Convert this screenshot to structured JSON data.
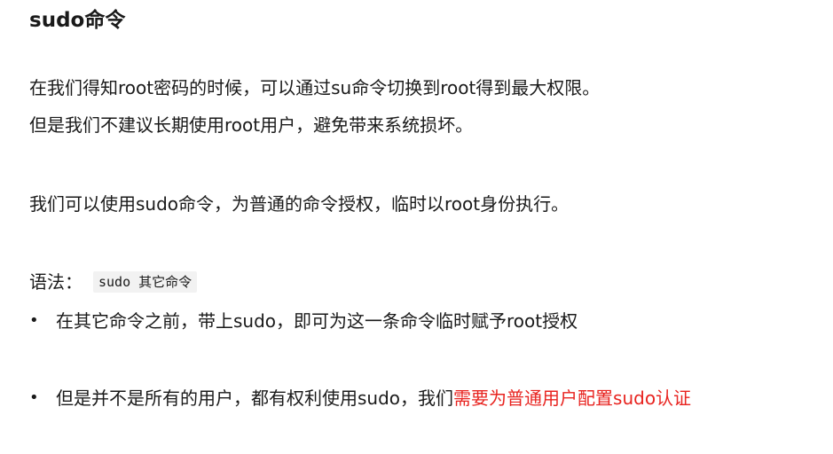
{
  "heading": "sudo命令",
  "paragraphs": [
    "在我们得知root密码的时候，可以通过su命令切换到root得到最大权限。",
    "但是我们不建议长期使用root用户，避免带来系统损坏。",
    "我们可以使用sudo命令，为普通的命令授权，临时以root身份执行。"
  ],
  "syntax": {
    "label": "语法：",
    "code": "sudo 其它命令"
  },
  "bullets": [
    {
      "marker": "•",
      "text": "在其它命令之前，带上sudo，即可为这一条命令临时赋予root授权",
      "highlight": ""
    },
    {
      "marker": "•",
      "text": "但是并不是所有的用户，都有权利使用sudo，我们",
      "highlight": "需要为普通用户配置sudo认证"
    }
  ],
  "colors": {
    "text": "#1a1a1a",
    "highlight": "#e8231f",
    "code_background": "#f2f2f2"
  }
}
